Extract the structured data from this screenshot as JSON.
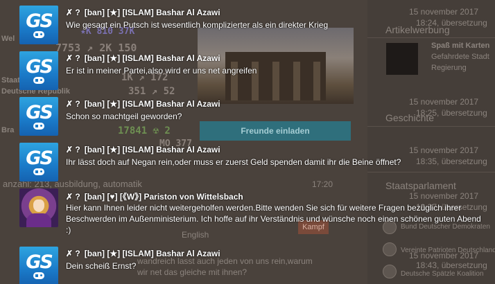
{
  "background": {
    "stats_row1": "★K 810 37K",
    "stats_row2": "7753 ↗ 2K 150",
    "stats_row3": "1K ↗ 172",
    "stats_row4": "351 ↗ 52",
    "stats_row5": "17841 ☢ 2",
    "stats_row6": "MO 377",
    "left_label1": "Wel",
    "left_label2": "Staat",
    "left_label3": "Deutsche Republik",
    "left_label4": "Bra",
    "friends_button": "Freunde einladen",
    "filter_text": "anzahl: 213, ausbildung, automatik",
    "time_text": "17:20",
    "language_text": "English",
    "kampf_button": "Kampf",
    "ghost_line1": "wandreich lasst auch jeden von uns rein,warum",
    "ghost_line2": "wir net das gleiche mit ihnen?",
    "side_dates": [
      "15 november 2017",
      "15 november 2017",
      "15 november 2017",
      "15 november 2017",
      "15 november 2017",
      "15 november 2017"
    ],
    "side_sub": [
      "18:24, übersetzung",
      "18:25, übersetzung",
      "18:35, übersetzung",
      "18:37, übersetzung",
      "18:43, übersetzung"
    ],
    "side_ad_title": "Artikelwerbung",
    "side_ad_line1": "Spaß mit Karten",
    "side_ad_line2": "Gefahrdete Stadt",
    "side_ad_line3": "Regierung",
    "side_history": "Geschichte",
    "side_parliament": "Staatsparlament",
    "side_party1": "Bund Deutscher Demokraten",
    "side_party2": "Vereinte Patrioten Deutschlands",
    "side_party3": "Deutsche Spätzle Koalition"
  },
  "messages": [
    {
      "icons": "✗ ?",
      "author": "[ban] [★] [ISLAM] Bashar Al Azawi",
      "text": "Wie gesagt ein Putsch ist wesentlich komplizierter als ein direkter Krieg",
      "avatar": "gs-logo"
    },
    {
      "icons": "✗ ?",
      "author": "[ban] [★] [ISLAM] Bashar Al Azawi",
      "text": "Er ist in meiner Partei,also wird er uns net angreifen",
      "avatar": "gs-logo"
    },
    {
      "icons": "✗ ?",
      "author": "[ban] [★] [ISLAM] Bashar Al Azawi",
      "text": "Schon so machtgeil geworden?",
      "avatar": "gs-logo"
    },
    {
      "icons": "✗ ?",
      "author": "[ban] [★] [ISLAM] Bashar Al Azawi",
      "text": "Ihr lässt doch auf Negan rein,oder muss er zuerst Geld spenden damit ihr die Beine öffnet?",
      "avatar": "gs-logo"
    },
    {
      "icons": "✗ ?",
      "author": "[ban] [♥] [《W》] Pariston von Wittelsbach",
      "text": "Hier kann Ihnen leider nicht weitergeholfen werden.Bitte wenden Sie sich für weitere Fragen bezüglich ihrer Beschwerden im Außenministerium. Ich hoffe auf ihr Verständnis und wünsche noch einen schönen guten Abend :)",
      "avatar": "anime-portrait"
    },
    {
      "icons": "✗ ?",
      "author": "[ban] [★] [ISLAM] Bashar Al Azawi",
      "text": "Dein scheiß Ernst?",
      "avatar": "gs-logo"
    }
  ],
  "avatar_logo_text": "GS",
  "colors": {
    "gs_blue": "#1a7ac8",
    "friends_button": "#2f6f7c"
  }
}
